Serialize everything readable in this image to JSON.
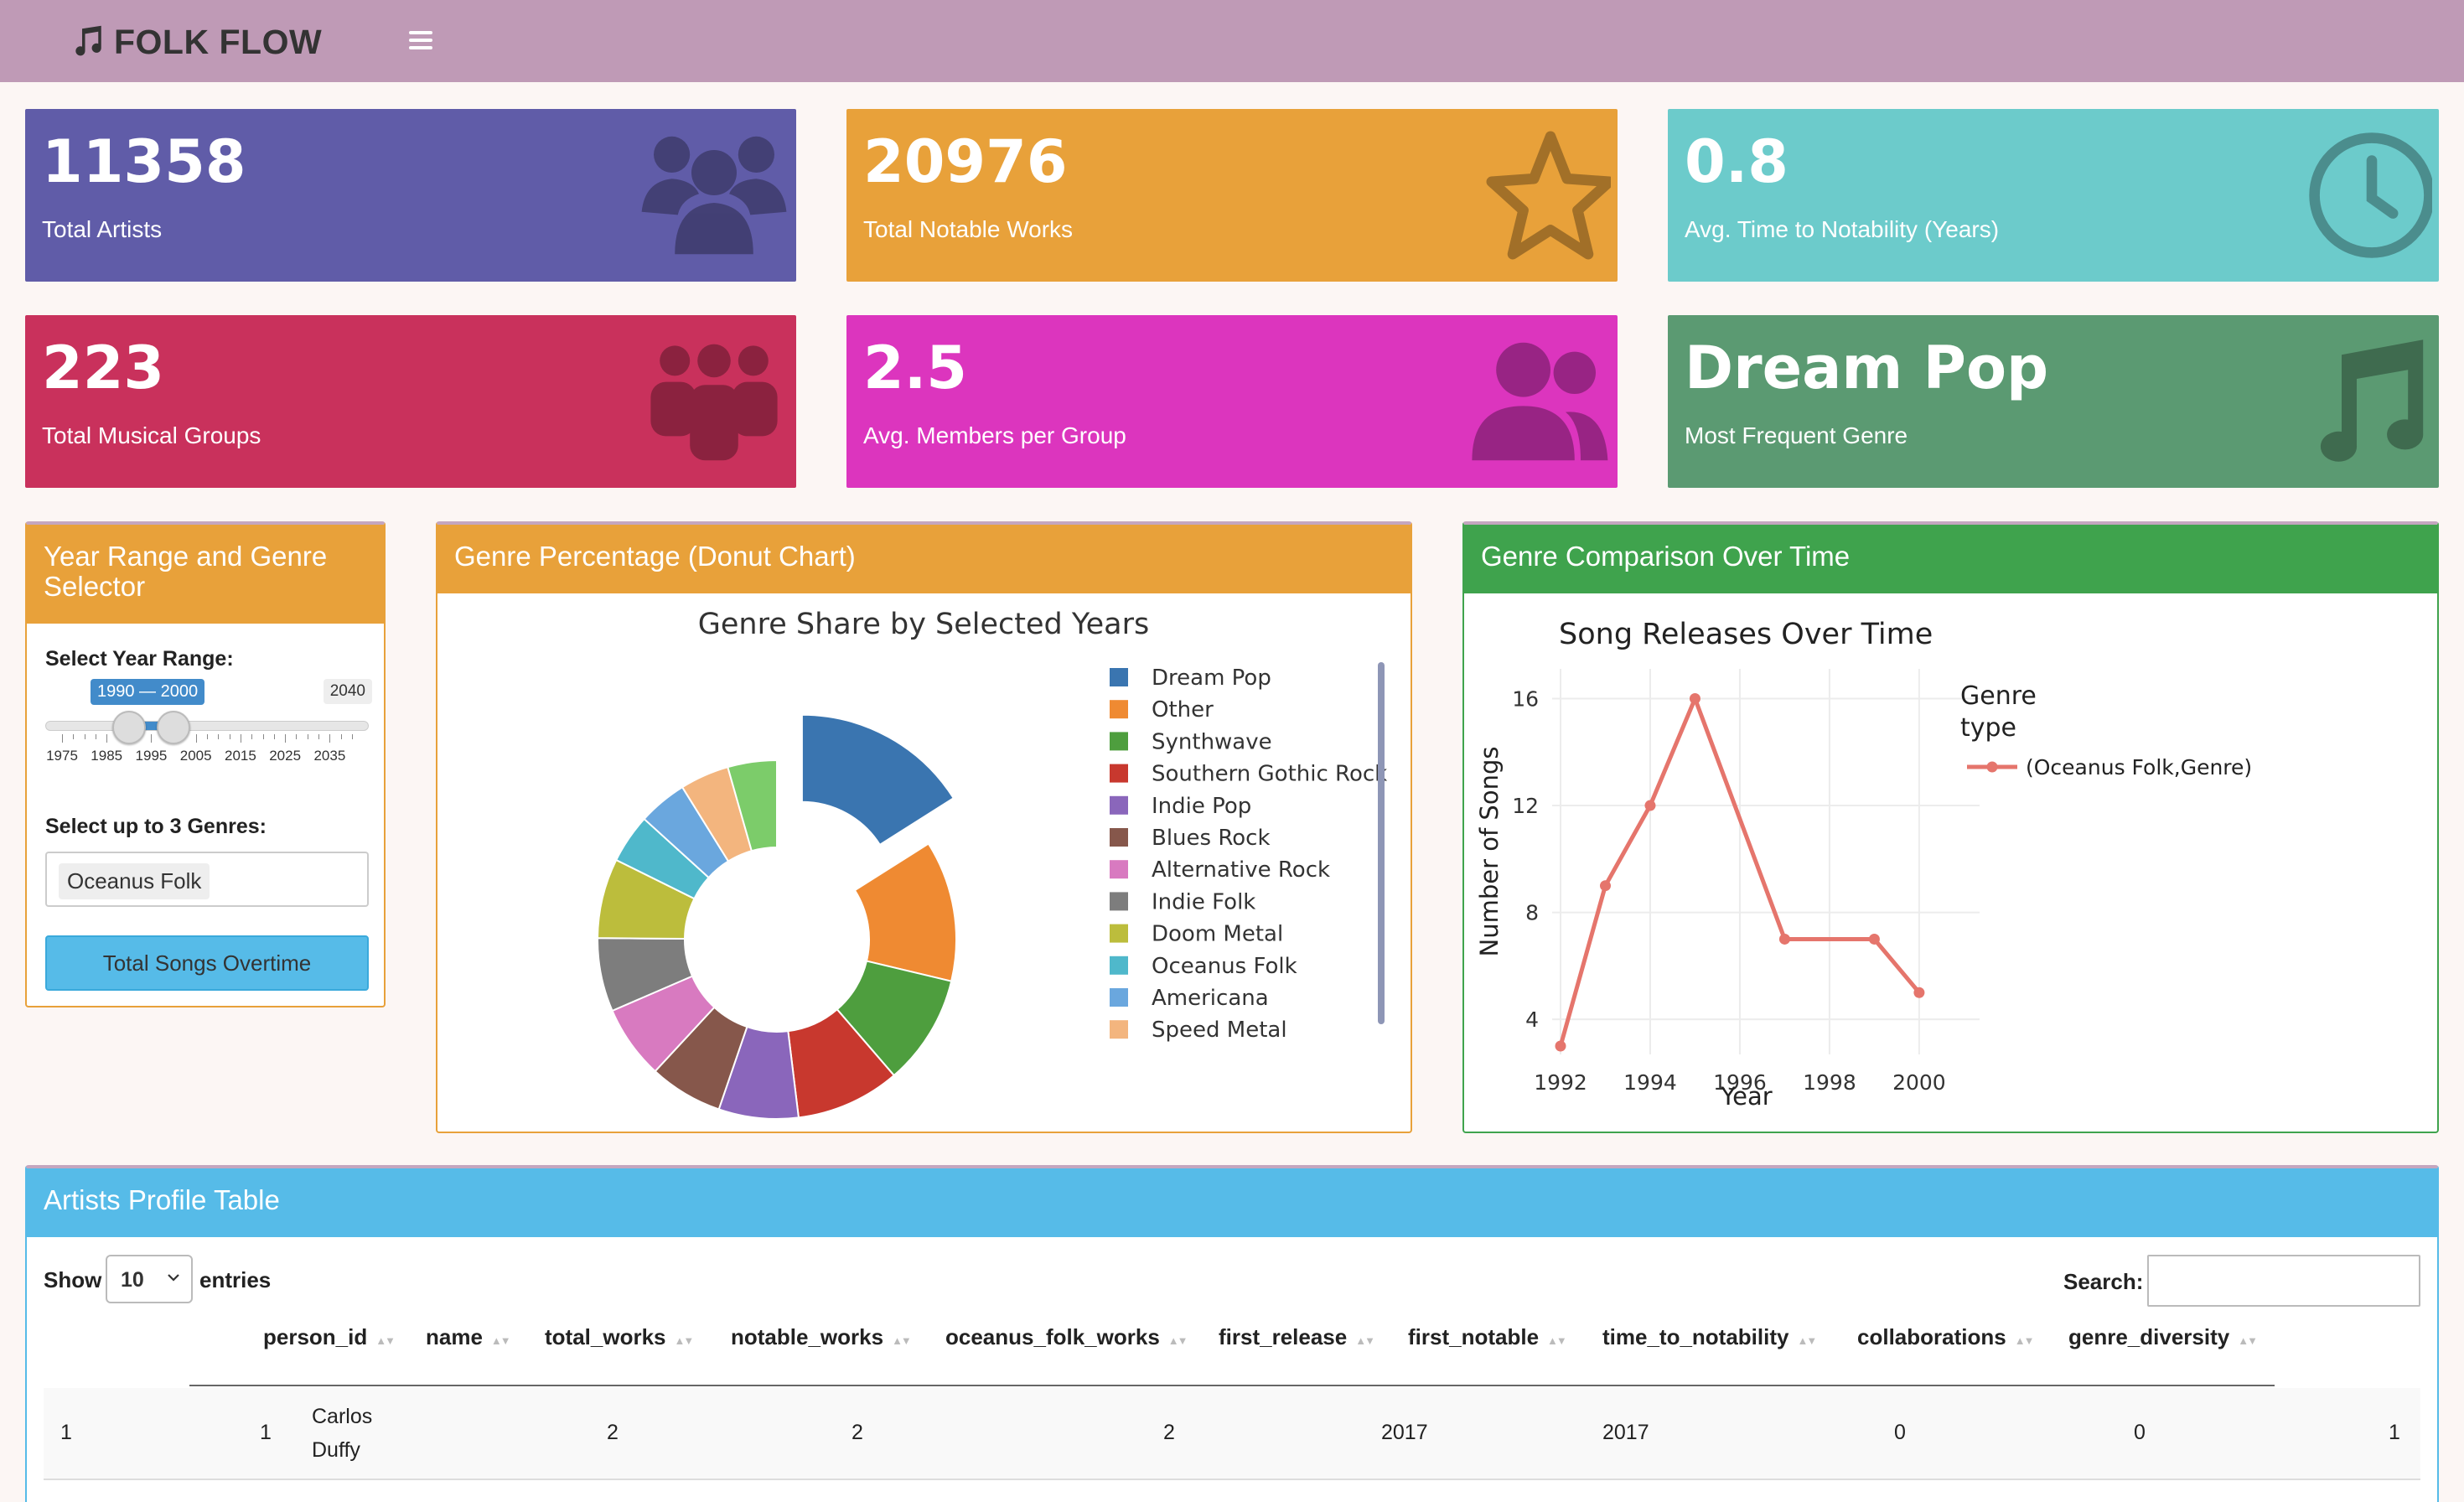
{
  "header": {
    "app_name": "FOLK FLOW"
  },
  "value_boxes": [
    {
      "value": "11358",
      "label": "Total Artists",
      "icon": "users-icon",
      "color": "#605ca8"
    },
    {
      "value": "20976",
      "label": "Total Notable Works",
      "icon": "star-icon",
      "color": "#e8a13a"
    },
    {
      "value": "0.8",
      "label": "Avg. Time to Notability (Years)",
      "icon": "clock-icon",
      "color": "#6ccbcb"
    },
    {
      "value": "223",
      "label": "Total Musical Groups",
      "icon": "group-icon",
      "color": "#c9315c"
    },
    {
      "value": "2.5",
      "label": "Avg. Members per Group",
      "icon": "user-friends-icon",
      "color": "#dc35be"
    },
    {
      "value": "Dream Pop",
      "label": "Most Frequent Genre",
      "icon": "music-icon",
      "color": "#5b9a72"
    }
  ],
  "selector": {
    "title": "Year Range and Genre Selector",
    "year_label": "Select Year Range:",
    "range_display": "1990 — 2000",
    "max_label": "2040",
    "ticks": [
      "1975",
      "1985",
      "1995",
      "2005",
      "2015",
      "2025",
      "2035"
    ],
    "range_value": [
      1990,
      2000
    ],
    "slider_min": 1975,
    "slider_max": 2040,
    "genre_label": "Select up to 3 Genres:",
    "selected_genre": "Oceanus Folk",
    "button_label": "Total Songs Overtime"
  },
  "donut_panel": {
    "title": "Genre Percentage (Donut Chart)"
  },
  "line_panel": {
    "title": "Genre Comparison Over Time"
  },
  "chart_data": [
    {
      "type": "pie",
      "title": "Genre Share by Selected Years",
      "hole": true,
      "slices": [
        {
          "label": "Dream Pop",
          "value": 14.5,
          "color": "#3a75b0",
          "pulled": true
        },
        {
          "label": "Other",
          "value": 11.5,
          "color": "#ef8a32"
        },
        {
          "label": "Synthwave",
          "value": 9,
          "color": "#4e9e3e"
        },
        {
          "label": "Southern Gothic Rock",
          "value": 8.5,
          "color": "#c8382e"
        },
        {
          "label": "Indie Pop",
          "value": 6.5,
          "color": "#8a66bb"
        },
        {
          "label": "Blues Rock",
          "value": 6,
          "color": "#86574b"
        },
        {
          "label": "Alternative Rock",
          "value": 6,
          "color": "#d87ac0"
        },
        {
          "label": "Indie Folk",
          "value": 6,
          "color": "#7d7d7d"
        },
        {
          "label": "Doom Metal",
          "value": 6.5,
          "color": "#bcbd3c"
        },
        {
          "label": "Oceanus Folk",
          "value": 4,
          "color": "#4fb8cb"
        },
        {
          "label": "Americana",
          "value": 4,
          "color": "#6aa7de"
        },
        {
          "label": "Speed Metal",
          "value": 4,
          "color": "#f3b57e"
        },
        {
          "label": "",
          "value": 4,
          "color": "#7ccc6a"
        }
      ]
    },
    {
      "type": "line",
      "title": "Song Releases Over Time",
      "xlabel": "Year",
      "ylabel": "Number of Songs",
      "legend_title": "Genre type",
      "x_ticks": [
        1992,
        1994,
        1996,
        1998,
        2000
      ],
      "y_ticks": [
        4,
        8,
        12,
        16
      ],
      "xlim": [
        1992,
        2000.6
      ],
      "ylim": [
        3,
        16.8
      ],
      "series": [
        {
          "name": "(Oceanus Folk,Genre)",
          "color": "#e5756c",
          "x": [
            1992,
            1993,
            1994,
            1995,
            1997,
            1999,
            2000
          ],
          "y": [
            3,
            9,
            12,
            16,
            7,
            7,
            5
          ]
        }
      ]
    }
  ],
  "table": {
    "title": "Artists Profile Table",
    "show_label": "Show",
    "entries_value": "10",
    "entries_label": "entries",
    "search_label": "Search:",
    "columns": [
      "person_id",
      "name",
      "total_works",
      "notable_works",
      "oceanus_folk_works",
      "first_release",
      "first_notable",
      "time_to_notability",
      "collaborations",
      "genre_diversity"
    ],
    "rows": [
      {
        "index": "1",
        "person_id": "1",
        "name_line1": "Carlos",
        "name_line2": "Duffy",
        "total_works": "2",
        "notable_works": "2",
        "oceanus_folk_works": "2",
        "first_release": "2017",
        "first_notable": "2017",
        "time_to_notability": "0",
        "collaborations": "0",
        "genre_diversity": "1"
      }
    ]
  }
}
